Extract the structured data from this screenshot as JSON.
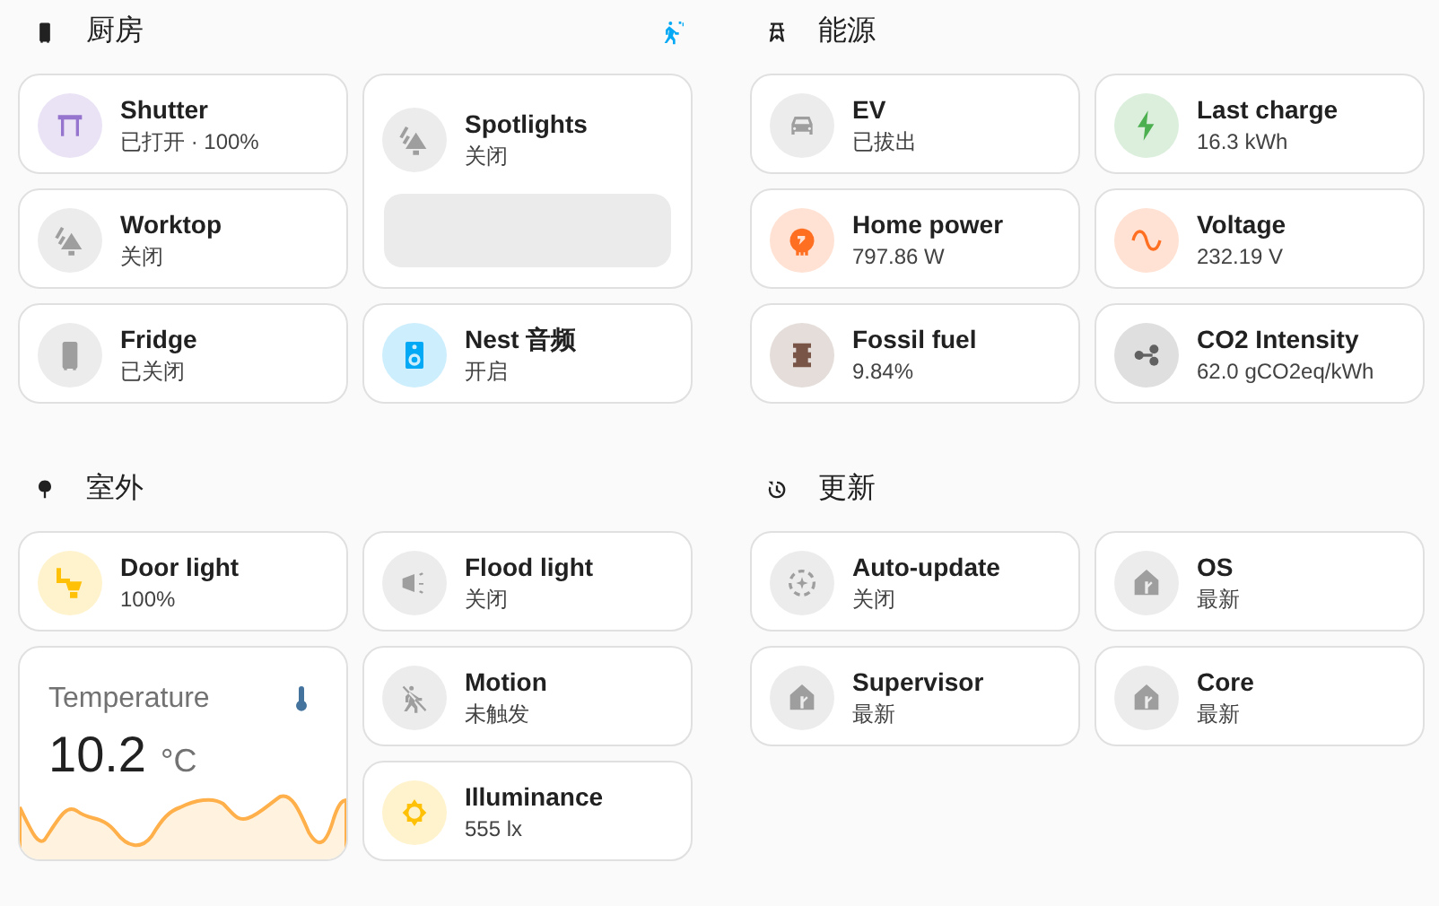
{
  "sections": [
    {
      "title": "厨房",
      "cards": [
        {
          "kind": "tile",
          "name": "Shutter",
          "state": "已打开 · 100%",
          "color": "#9575cd"
        },
        {
          "kind": "light-control",
          "name": "Spotlights",
          "state": "关闭",
          "color": "#9e9e9e"
        },
        {
          "kind": "tile",
          "name": "Worktop",
          "state": "关闭",
          "color": "#9e9e9e"
        },
        {
          "kind": "tile",
          "name": "Fridge",
          "state": "已关闭",
          "color": "#9e9e9e"
        },
        {
          "kind": "tile",
          "name": "Nest 音频",
          "state": "开启",
          "color": "#03a9f4"
        }
      ]
    },
    {
      "title": "能源",
      "cards": [
        {
          "kind": "tile",
          "name": "EV",
          "state": "已拔出",
          "color": "#9e9e9e"
        },
        {
          "kind": "tile",
          "name": "Last charge",
          "state": "16.3 kWh",
          "color": "#4caf50"
        },
        {
          "kind": "tile",
          "name": "Home power",
          "state": "797.86 W",
          "color": "#ff6f22"
        },
        {
          "kind": "tile",
          "name": "Voltage",
          "state": "232.19 V",
          "color": "#ff6f22"
        },
        {
          "kind": "tile",
          "name": "Fossil fuel",
          "state": "9.84%",
          "color": "#795548"
        },
        {
          "kind": "tile",
          "name": "CO2 Intensity",
          "state": "62.0 gCO2eq/kWh",
          "color": "#616161"
        }
      ]
    },
    {
      "title": "室外",
      "cards": [
        {
          "kind": "tile",
          "name": "Door light",
          "state": "100%",
          "color": "#ffc107"
        },
        {
          "kind": "tile",
          "name": "Flood light",
          "state": "关闭",
          "color": "#9e9e9e"
        },
        {
          "kind": "sensor-graph",
          "name": "Temperature",
          "value": "10.2",
          "unit": "°C"
        },
        {
          "kind": "tile",
          "name": "Motion",
          "state": "未触发",
          "color": "#9e9e9e"
        },
        {
          "kind": "tile",
          "name": "Illuminance",
          "state": "555 lx",
          "color": "#ffc107"
        }
      ]
    },
    {
      "title": "更新",
      "cards": [
        {
          "kind": "tile",
          "name": "Auto-update",
          "state": "关闭",
          "color": "#9e9e9e"
        },
        {
          "kind": "tile",
          "name": "OS",
          "state": "最新",
          "color": "#9e9e9e"
        },
        {
          "kind": "tile",
          "name": "Supervisor",
          "state": "最新",
          "color": "#9e9e9e"
        },
        {
          "kind": "tile",
          "name": "Core",
          "state": "最新",
          "color": "#9e9e9e"
        }
      ]
    }
  ]
}
